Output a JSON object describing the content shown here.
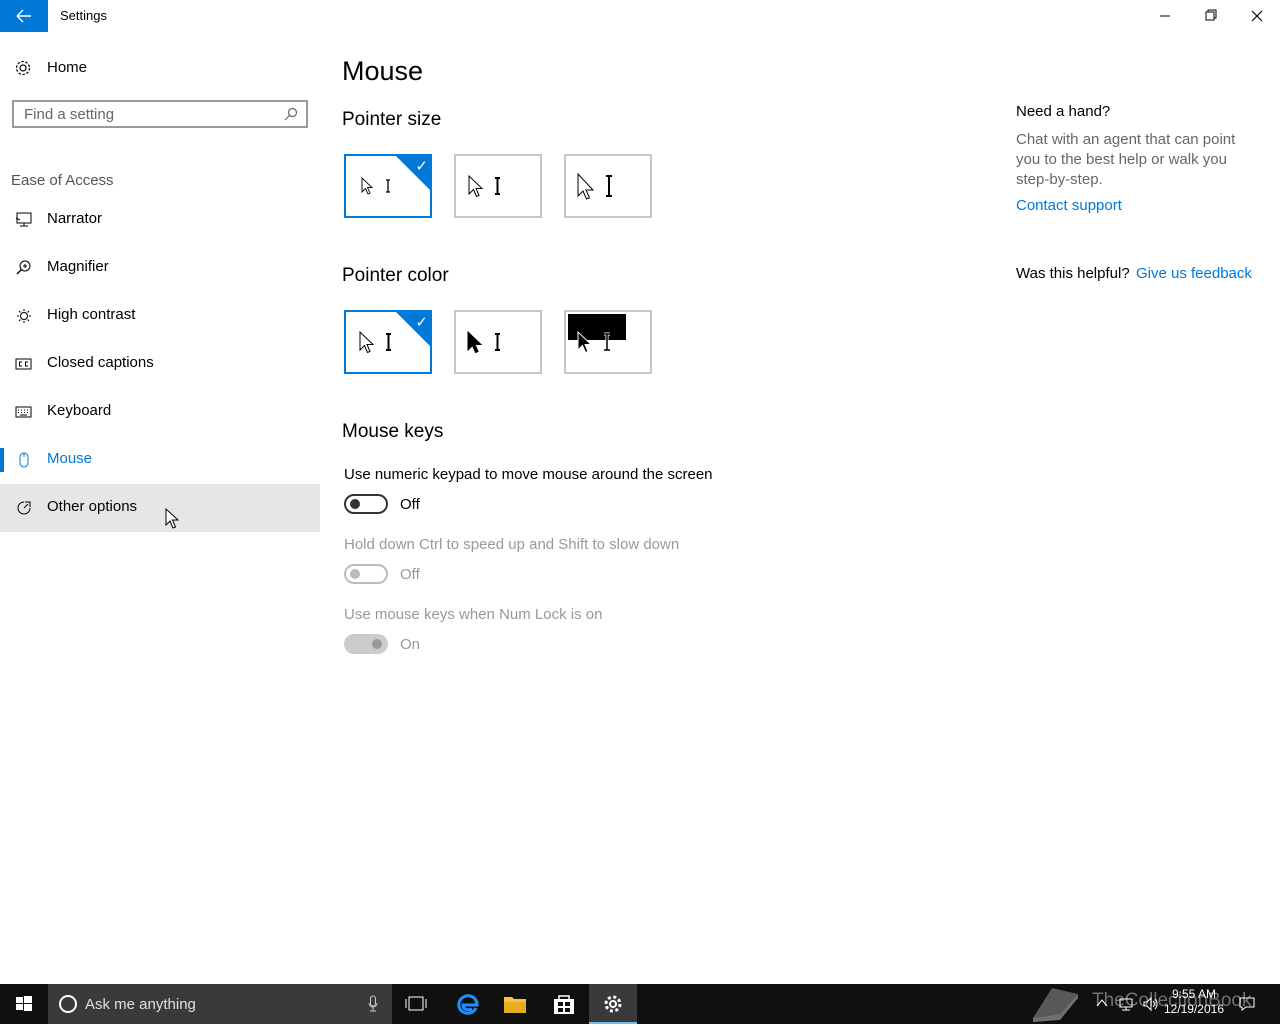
{
  "window": {
    "title": "Settings"
  },
  "sidebar": {
    "home_label": "Home",
    "search_placeholder": "Find a setting",
    "section": "Ease of Access",
    "items": [
      {
        "label": "Narrator",
        "icon": "narrator-icon"
      },
      {
        "label": "Magnifier",
        "icon": "magnifier-icon"
      },
      {
        "label": "High contrast",
        "icon": "high-contrast-icon"
      },
      {
        "label": "Closed captions",
        "icon": "closed-captions-icon"
      },
      {
        "label": "Keyboard",
        "icon": "keyboard-icon"
      },
      {
        "label": "Mouse",
        "icon": "mouse-icon",
        "selected": true
      },
      {
        "label": "Other options",
        "icon": "other-options-icon",
        "hovered": true
      }
    ]
  },
  "main": {
    "title": "Mouse",
    "pointer_size": {
      "heading": "Pointer size",
      "options": [
        "small",
        "medium",
        "large"
      ],
      "selected": 0
    },
    "pointer_color": {
      "heading": "Pointer color",
      "options": [
        "white",
        "black",
        "inverted"
      ],
      "selected": 0
    },
    "mouse_keys": {
      "heading": "Mouse keys",
      "settings": [
        {
          "label": "Use numeric keypad to move mouse around the screen",
          "state": "Off",
          "enabled": true
        },
        {
          "label": "Hold down Ctrl to speed up and Shift to slow down",
          "state": "Off",
          "enabled": false
        },
        {
          "label": "Use mouse keys when Num Lock is on",
          "state": "On",
          "enabled": false
        }
      ]
    }
  },
  "help": {
    "title": "Need a hand?",
    "body": "Chat with an agent that can point you to the best help or walk you step-by-step.",
    "link": "Contact support",
    "helpful_question": "Was this helpful?",
    "feedback_link": "Give us feedback"
  },
  "taskbar": {
    "search_placeholder": "Ask me anything",
    "time": "9:55 AM",
    "date": "12/19/2016",
    "watermark": "TheCollectionBook"
  },
  "colors": {
    "accent": "#0078d7",
    "taskbar": "#101010",
    "hover": "#e6e6e6"
  }
}
